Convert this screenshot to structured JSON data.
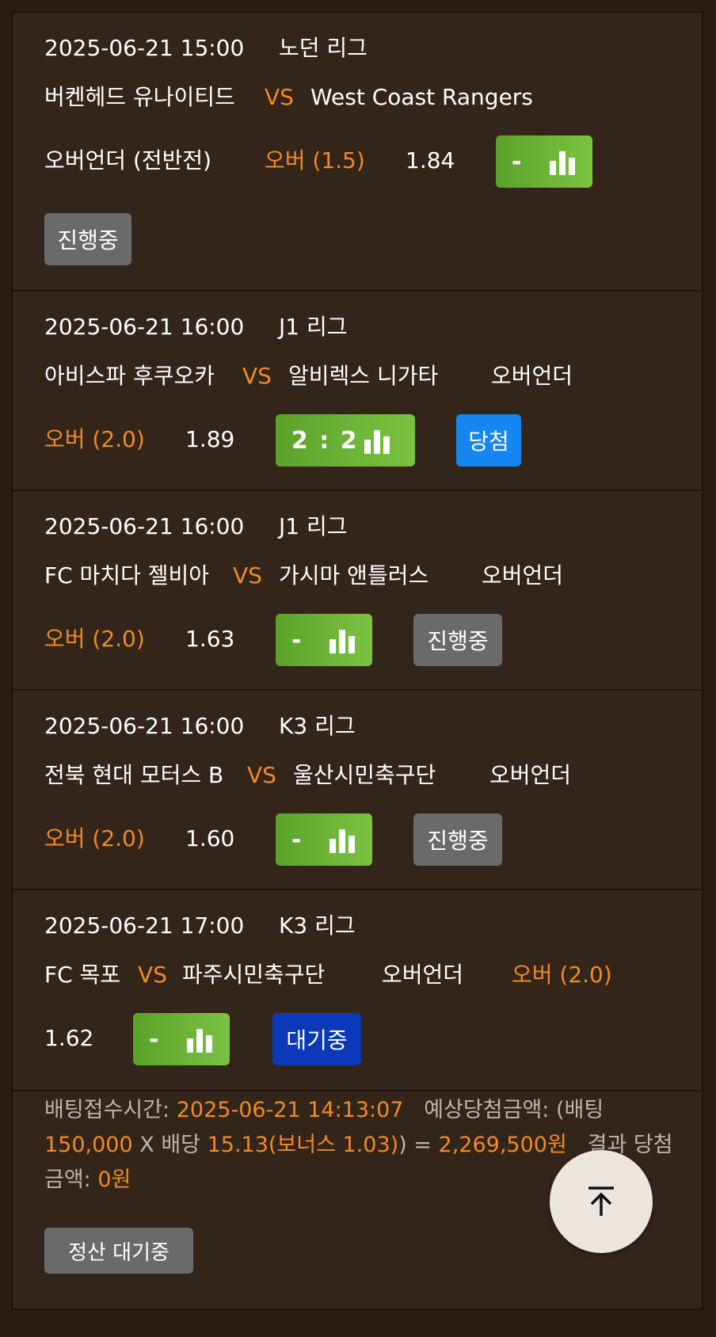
{
  "bets": [
    {
      "datetime": "2025-06-21 15:00",
      "league": "노던 리그",
      "home": "버켄헤드 유나이티드",
      "vs": "VS",
      "away": "West Coast Rangers",
      "market": "오버언더 (전반전)",
      "pick": "오버 (1.5)",
      "odds": "1.84",
      "score": "-",
      "status": "진행중",
      "status_color": "#6a6a6a"
    },
    {
      "datetime": "2025-06-21 16:00",
      "league": "J1 리그",
      "home": "아비스파 후쿠오카",
      "vs": "VS",
      "away": "알비렉스 니가타",
      "market": "오버언더",
      "pick": "오버 (2.0)",
      "odds": "1.89",
      "score": "2 : 2",
      "status": "당첨",
      "status_color": "#1686f0"
    },
    {
      "datetime": "2025-06-21 16:00",
      "league": "J1 리그",
      "home": "FC 마치다 젤비아",
      "vs": "VS",
      "away": "가시마 앤틀러스",
      "market": "오버언더",
      "pick": "오버 (2.0)",
      "odds": "1.63",
      "score": "-",
      "status": "진행중",
      "status_color": "#6a6a6a"
    },
    {
      "datetime": "2025-06-21 16:00",
      "league": "K3 리그",
      "home": "전북 현대 모터스 B",
      "vs": "VS",
      "away": "울산시민축구단",
      "market": "오버언더",
      "pick": "오버 (2.0)",
      "odds": "1.60",
      "score": "-",
      "status": "진행중",
      "status_color": "#6a6a6a"
    },
    {
      "datetime": "2025-06-21 17:00",
      "league": "K3 리그",
      "home": "FC 목포",
      "vs": "VS",
      "away": "파주시민축구단",
      "market": "오버언더",
      "pick": "오버 (2.0)",
      "odds": "1.62",
      "score": "-",
      "status": "대기중",
      "status_color": "#0b39b8"
    }
  ],
  "footer": {
    "accept_time_label": "배팅접수시간:",
    "accept_time_value": "2025-06-21 14:13:07",
    "expected_label": "예상당첨금액: (배팅",
    "stake": "150,000",
    "x_label": "X 배당",
    "total_odds": "15.13(보너스 1.03)",
    "equals": ") =",
    "expected_amount": "2,269,500원",
    "result_label": "결과 당첨금액:",
    "result_amount": "0원",
    "settle_button": "정산 대기중"
  },
  "colors": {
    "accent": "#f08a24",
    "score_green": "#6bb236",
    "background": "#34251a"
  },
  "icons": {
    "score_chart": "bar-chart-icon",
    "scroll_top": "arrow-up-to-line-icon"
  }
}
